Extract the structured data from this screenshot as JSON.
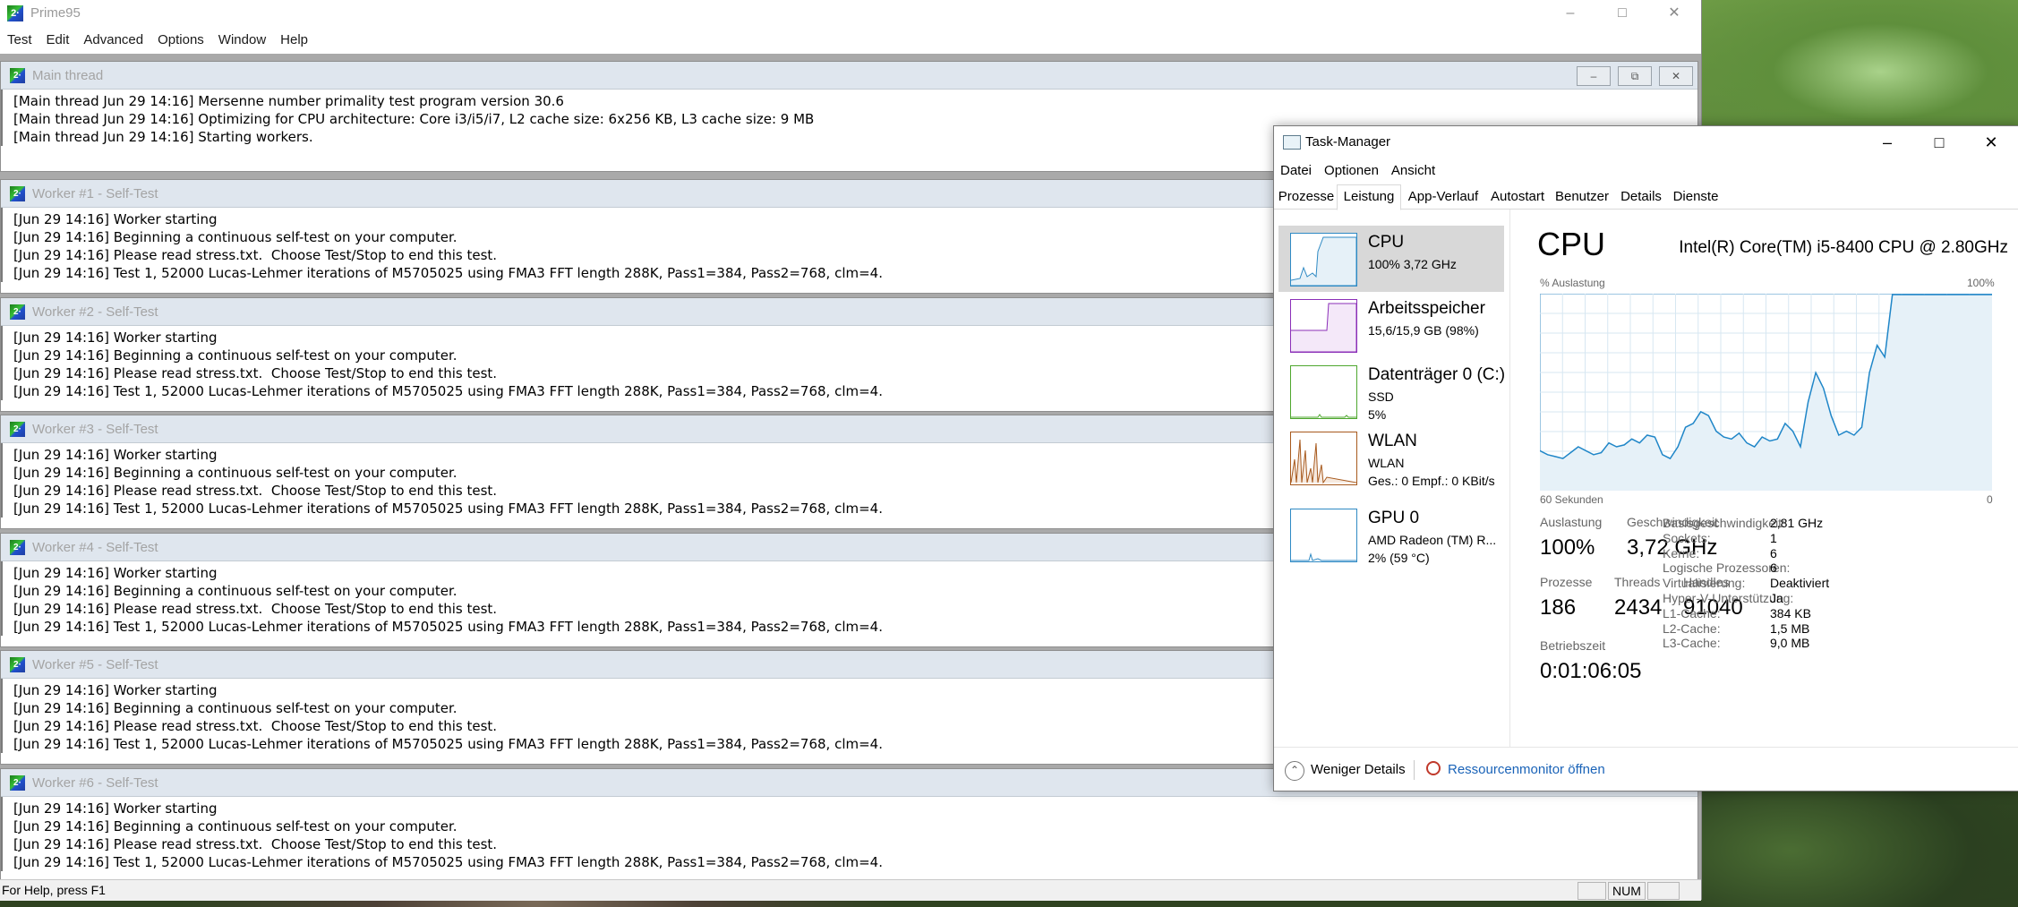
{
  "prime95": {
    "title": "Prime95",
    "icon_text": "2·",
    "menu": [
      "Test",
      "Edit",
      "Advanced",
      "Options",
      "Window",
      "Help"
    ],
    "main_thread": {
      "title": "Main thread",
      "lines": [
        "[Main thread Jun 29 14:16] Mersenne number primality test program version 30.6",
        "[Main thread Jun 29 14:16] Optimizing for CPU architecture: Core i3/i5/i7, L2 cache size: 6x256 KB, L3 cache size: 9 MB",
        "[Main thread Jun 29 14:16] Starting workers."
      ]
    },
    "workers": [
      {
        "title": "Worker #1 - Self-Test",
        "lines": [
          "[Jun 29 14:16] Worker starting",
          "[Jun 29 14:16] Beginning a continuous self-test on your computer.",
          "[Jun 29 14:16] Please read stress.txt.  Choose Test/Stop to end this test.",
          "[Jun 29 14:16] Test 1, 52000 Lucas-Lehmer iterations of M5705025 using FMA3 FFT length 288K, Pass1=384, Pass2=768, clm=4."
        ]
      },
      {
        "title": "Worker #2 - Self-Test",
        "lines": [
          "[Jun 29 14:16] Worker starting",
          "[Jun 29 14:16] Beginning a continuous self-test on your computer.",
          "[Jun 29 14:16] Please read stress.txt.  Choose Test/Stop to end this test.",
          "[Jun 29 14:16] Test 1, 52000 Lucas-Lehmer iterations of M5705025 using FMA3 FFT length 288K, Pass1=384, Pass2=768, clm=4."
        ]
      },
      {
        "title": "Worker #3 - Self-Test",
        "lines": [
          "[Jun 29 14:16] Worker starting",
          "[Jun 29 14:16] Beginning a continuous self-test on your computer.",
          "[Jun 29 14:16] Please read stress.txt.  Choose Test/Stop to end this test.",
          "[Jun 29 14:16] Test 1, 52000 Lucas-Lehmer iterations of M5705025 using FMA3 FFT length 288K, Pass1=384, Pass2=768, clm=4."
        ]
      },
      {
        "title": "Worker #4 - Self-Test",
        "lines": [
          "[Jun 29 14:16] Worker starting",
          "[Jun 29 14:16] Beginning a continuous self-test on your computer.",
          "[Jun 29 14:16] Please read stress.txt.  Choose Test/Stop to end this test.",
          "[Jun 29 14:16] Test 1, 52000 Lucas-Lehmer iterations of M5705025 using FMA3 FFT length 288K, Pass1=384, Pass2=768, clm=4."
        ]
      },
      {
        "title": "Worker #5 - Self-Test",
        "lines": [
          "[Jun 29 14:16] Worker starting",
          "[Jun 29 14:16] Beginning a continuous self-test on your computer.",
          "[Jun 29 14:16] Please read stress.txt.  Choose Test/Stop to end this test.",
          "[Jun 29 14:16] Test 1, 52000 Lucas-Lehmer iterations of M5705025 using FMA3 FFT length 288K, Pass1=384, Pass2=768, clm=4."
        ]
      },
      {
        "title": "Worker #6 - Self-Test",
        "lines": [
          "[Jun 29 14:16] Worker starting",
          "[Jun 29 14:16] Beginning a continuous self-test on your computer.",
          "[Jun 29 14:16] Please read stress.txt.  Choose Test/Stop to end this test.",
          "[Jun 29 14:16] Test 1, 52000 Lucas-Lehmer iterations of M5705025 using FMA3 FFT length 288K, Pass1=384, Pass2=768, clm=4."
        ]
      }
    ],
    "status": {
      "help": "For Help, press F1",
      "num": "NUM"
    }
  },
  "taskmanager": {
    "title": "Task-Manager",
    "menu": [
      "Datei",
      "Optionen",
      "Ansicht"
    ],
    "tabs": [
      "Prozesse",
      "Leistung",
      "App-Verlauf",
      "Autostart",
      "Benutzer",
      "Details",
      "Dienste"
    ],
    "active_tab": "Leistung",
    "resources": [
      {
        "name": "CPU",
        "sub": "100%  3,72 GHz",
        "sub2": "",
        "color": "#2f8ac4"
      },
      {
        "name": "Arbeitsspeicher",
        "sub": "15,6/15,9 GB (98%)",
        "sub2": "",
        "color": "#8b2fb8"
      },
      {
        "name": "Datenträger 0 (C:)",
        "sub": "SSD",
        "sub2": "5%",
        "color": "#4ea72e"
      },
      {
        "name": "WLAN",
        "sub": "WLAN",
        "sub2": "Ges.: 0  Empf.: 0 KBit/s",
        "color": "#a7591d"
      },
      {
        "name": "GPU 0",
        "sub": "AMD Radeon (TM) R...",
        "sub2": "2% (59 °C)",
        "color": "#2f8ac4"
      }
    ],
    "cpu": {
      "heading": "CPU",
      "model": "Intel(R) Core(TM) i5-8400 CPU @ 2.80GHz",
      "graph_label_left": "% Auslastung",
      "graph_label_right": "100%",
      "graph_bottom_left": "60 Sekunden",
      "graph_bottom_right": "0",
      "stats": {
        "auslastung_label": "Auslastung",
        "auslastung": "100%",
        "geschwindigkeit_label": "Geschwindigkeit",
        "geschwindigkeit": "3,72 GHz",
        "prozesse_label": "Prozesse",
        "prozesse": "186",
        "threads_label": "Threads",
        "threads": "2434",
        "handles_label": "Handles",
        "handles": "91040",
        "betriebszeit_label": "Betriebszeit",
        "betriebszeit": "0:01:06:05"
      },
      "details": [
        {
          "key": "Basisgeschwindigkeit:",
          "value": "2,81 GHz"
        },
        {
          "key": "Sockets:",
          "value": "1"
        },
        {
          "key": "Kerne:",
          "value": "6"
        },
        {
          "key": "Logische Prozessoren:",
          "value": "6"
        },
        {
          "key": "Virtualisierung:",
          "value": "Deaktiviert"
        },
        {
          "key": "Hyper-V-Unterstützung:",
          "value": "Ja"
        },
        {
          "key": "L1-Cache:",
          "value": "384 KB"
        },
        {
          "key": "L2-Cache:",
          "value": "1,5 MB"
        },
        {
          "key": "L3-Cache:",
          "value": "9,0 MB"
        }
      ]
    },
    "footer": {
      "fewer": "Weniger Details",
      "resmon": "Ressourcenmonitor öffnen"
    },
    "colors": {
      "cpu_line": "#1f86c8",
      "cpu_fill": "#e6f1f8",
      "grid": "#d7e7f2"
    }
  },
  "chart_data": {
    "type": "area",
    "y": [
      20,
      18,
      17,
      16,
      19,
      22,
      20,
      18,
      19,
      24,
      22,
      23,
      26,
      24,
      28,
      27,
      18,
      16,
      22,
      32,
      34,
      40,
      38,
      30,
      27,
      26,
      29,
      24,
      22,
      27,
      25,
      26,
      34,
      30,
      22,
      45,
      60,
      52,
      38,
      28,
      30,
      28,
      32,
      60,
      74,
      68,
      100,
      100,
      100,
      100,
      100,
      100,
      100,
      100,
      100,
      100,
      100,
      100,
      100,
      100
    ],
    "ylim": [
      0,
      100
    ]
  }
}
